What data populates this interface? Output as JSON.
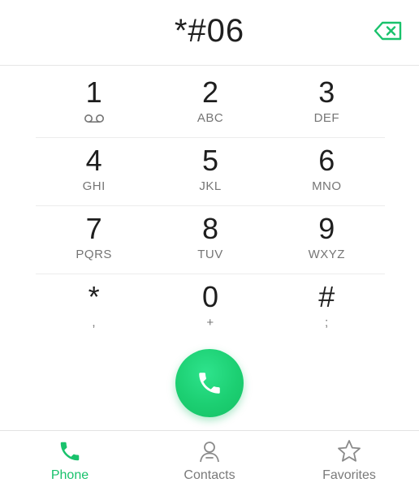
{
  "display": {
    "number": "*#06"
  },
  "keypad": {
    "rows": [
      [
        {
          "digit": "1",
          "letters": "",
          "sub_icon": "voicemail-icon"
        },
        {
          "digit": "2",
          "letters": "ABC"
        },
        {
          "digit": "3",
          "letters": "DEF"
        }
      ],
      [
        {
          "digit": "4",
          "letters": "GHI"
        },
        {
          "digit": "5",
          "letters": "JKL"
        },
        {
          "digit": "6",
          "letters": "MNO"
        }
      ],
      [
        {
          "digit": "7",
          "letters": "PQRS"
        },
        {
          "digit": "8",
          "letters": "TUV"
        },
        {
          "digit": "9",
          "letters": "WXYZ"
        }
      ],
      [
        {
          "digit": "*",
          "letters": ","
        },
        {
          "digit": "0",
          "letters": "+"
        },
        {
          "digit": "#",
          "letters": ";"
        }
      ]
    ]
  },
  "call": {
    "icon": "phone-handset-icon"
  },
  "nav": {
    "items": [
      {
        "label": "Phone",
        "icon": "phone-icon",
        "active": true
      },
      {
        "label": "Contacts",
        "icon": "person-icon",
        "active": false
      },
      {
        "label": "Favorites",
        "icon": "star-icon",
        "active": false
      }
    ]
  },
  "colors": {
    "accent": "#19c26c",
    "call_button": "#1ccf72",
    "inactive": "#7a7a7a"
  }
}
